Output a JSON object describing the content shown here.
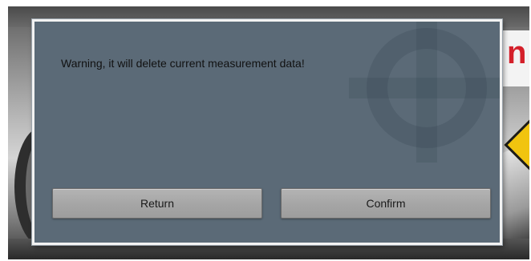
{
  "dialog": {
    "message": "Warning, it will delete current measurement data!",
    "buttons": {
      "return_label": "Return",
      "confirm_label": "Confirm"
    }
  },
  "colors": {
    "dialog_background": "#5b6a77",
    "dialog_border": "#f2f2f2",
    "button_background": "#a6a6a6",
    "background_accent": "#d4202a",
    "warning_sign": "#f1c40f"
  },
  "icons": [
    "gear-watermark-icon",
    "warning-sign-icon"
  ]
}
